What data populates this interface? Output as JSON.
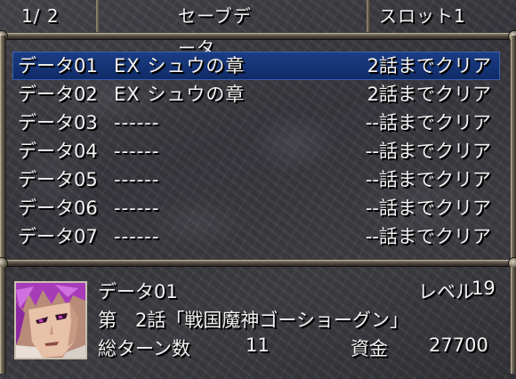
{
  "header": {
    "page_counter": "1/ 2",
    "title": "セーブデータ",
    "slot": "スロット1"
  },
  "save_slots": [
    {
      "name": "データ01",
      "scenario": "EX シュウの章",
      "progress": "2話までクリア",
      "selected": true
    },
    {
      "name": "データ02",
      "scenario": "EX シュウの章",
      "progress": "2話までクリア",
      "selected": false
    },
    {
      "name": "データ03",
      "scenario": "------",
      "progress": "--話までクリア",
      "selected": false
    },
    {
      "name": "データ04",
      "scenario": "------",
      "progress": "--話までクリア",
      "selected": false
    },
    {
      "name": "データ05",
      "scenario": "------",
      "progress": "--話までクリア",
      "selected": false
    },
    {
      "name": "データ06",
      "scenario": "------",
      "progress": "--話までクリア",
      "selected": false
    },
    {
      "name": "データ07",
      "scenario": "------",
      "progress": "--話までクリア",
      "selected": false
    }
  ],
  "detail": {
    "data_name": "データ01",
    "level_label": "レベル",
    "level_value": "19",
    "chapter": "第　2話「戦国魔神ゴーショーグン」",
    "turns_label": "総ターン数",
    "turns_value": "11",
    "funds_label": "資金",
    "funds_value": "27700"
  },
  "colors": {
    "selection": "#1c3e86",
    "text": "#f2f2f2",
    "frame": "#8a8070"
  },
  "portrait_icon": "purple-haired-character-portrait"
}
